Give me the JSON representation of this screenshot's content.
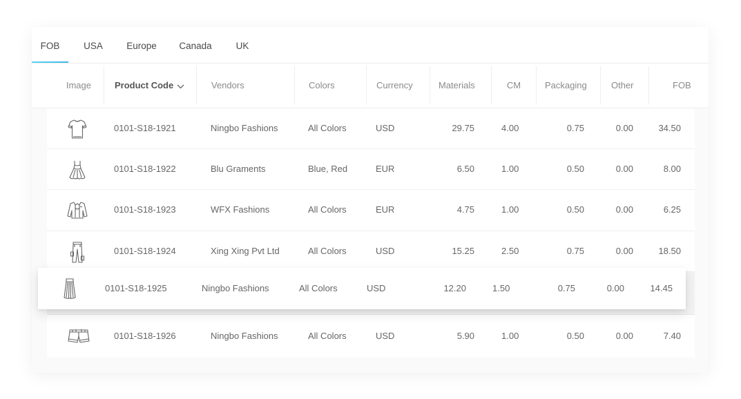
{
  "tabs": [
    {
      "label": "FOB",
      "active": true
    },
    {
      "label": "USA",
      "active": false
    },
    {
      "label": "Europe",
      "active": false
    },
    {
      "label": "Canada",
      "active": false
    },
    {
      "label": "UK",
      "active": false
    }
  ],
  "columns": {
    "image": "Image",
    "product_code": "Product Code",
    "vendors": "Vendors",
    "colors": "Colors",
    "currency": "Currency",
    "materials": "Materials",
    "cm": "CM",
    "packaging": "Packaging",
    "other": "Other",
    "fob": "FOB"
  },
  "sort": {
    "column": "Product Code",
    "icon": "chevron-down-icon"
  },
  "rows": [
    {
      "icon": "tshirt-icon",
      "product_code": "0101-S18-1921",
      "vendor": "Ningbo Fashions",
      "colors": "All Colors",
      "currency": "USD",
      "materials": "29.75",
      "cm": "4.00",
      "packaging": "0.75",
      "other": "0.00",
      "fob": "34.50"
    },
    {
      "icon": "dress-icon",
      "product_code": "0101-S18-1922",
      "vendor": "Blu Graments",
      "colors": "Blue, Red",
      "currency": "EUR",
      "materials": "6.50",
      "cm": "1.00",
      "packaging": "0.50",
      "other": "0.00",
      "fob": "8.00"
    },
    {
      "icon": "jacket-icon",
      "product_code": "0101-S18-1923",
      "vendor": "WFX Fashions",
      "colors": "All Colors",
      "currency": "EUR",
      "materials": "4.75",
      "cm": "1.00",
      "packaging": "0.50",
      "other": "0.00",
      "fob": "6.25"
    },
    {
      "icon": "trousers-icon",
      "product_code": "0101-S18-1924",
      "vendor": "Xing Xing Pvt Ltd",
      "colors": "All Colors",
      "currency": "USD",
      "materials": "15.25",
      "cm": "2.50",
      "packaging": "0.75",
      "other": "0.00",
      "fob": "18.50"
    },
    {
      "icon": "skirt-icon",
      "product_code": "0101-S18-1925",
      "vendor": "Ningbo Fashions",
      "colors": "All Colors",
      "currency": "USD",
      "materials": "12.20",
      "cm": "1.50",
      "packaging": "0.75",
      "other": "0.00",
      "fob": "14.45",
      "dragging": true
    },
    {
      "icon": "shorts-icon",
      "product_code": "0101-S18-1926",
      "vendor": "Ningbo Fashions",
      "colors": "All Colors",
      "currency": "USD",
      "materials": "5.90",
      "cm": "1.00",
      "packaging": "0.50",
      "other": "0.00",
      "fob": "7.40"
    }
  ]
}
